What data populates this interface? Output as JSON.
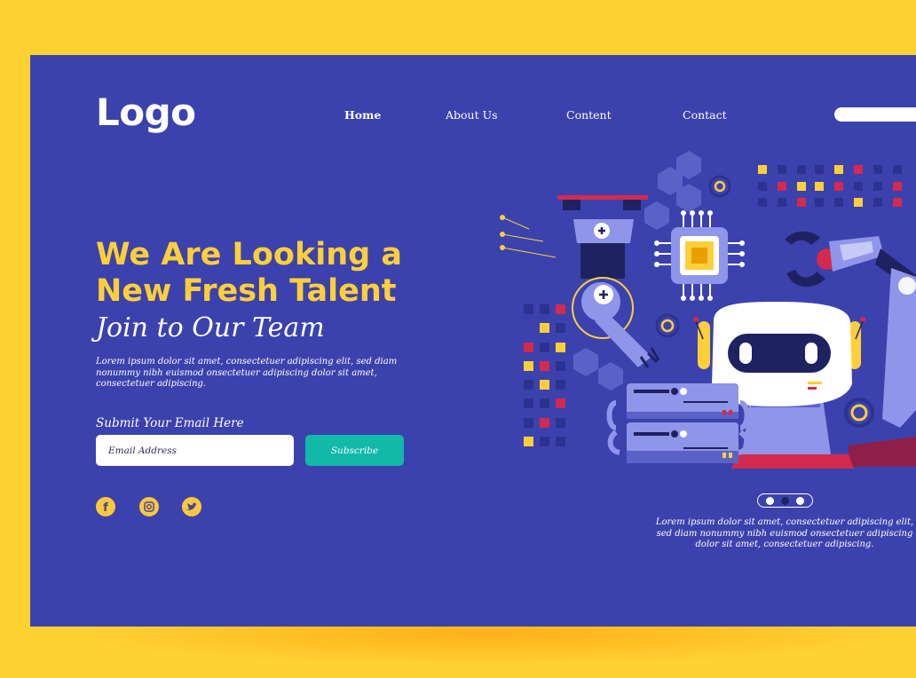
{
  "brand": {
    "logo_text": "Logo"
  },
  "nav": {
    "items": [
      {
        "label": "Home",
        "active": true
      },
      {
        "label": "About Us",
        "active": false
      },
      {
        "label": "Content",
        "active": false
      },
      {
        "label": "Contact",
        "active": false
      }
    ]
  },
  "hero": {
    "headline_line1": "We Are Looking a",
    "headline_line2": "New Fresh Talent",
    "subheadline": "Join to Our Team",
    "body": "Lorem ipsum dolor sit amet, consectetuer adipiscing elit, sed diam nonummy nibh euismod onsectetuer adipiscing dolor sit amet, consectetuer adipiscing."
  },
  "form": {
    "label": "Submit Your Email Here",
    "email_placeholder": "Email Address",
    "subscribe_label": "Subscribe"
  },
  "social": {
    "icons": [
      "facebook-icon",
      "instagram-icon",
      "twitter-icon"
    ]
  },
  "slider": {
    "caption": "Lorem ipsum dolor sit amet, consectetuer adipiscing elit, sed diam nonummy nibh euismod onsectetuer adipiscing dolor sit amet, consectetuer adipiscing.",
    "slides": 3,
    "active_slide": 2
  },
  "colors": {
    "background": "#ffd233",
    "panel": "#3b42ad",
    "accent_yellow": "#ffcf3a",
    "subscribe_button": "#12b8a8",
    "pixel_red": "#d42a4e",
    "robot_light": "#8f95e8"
  }
}
